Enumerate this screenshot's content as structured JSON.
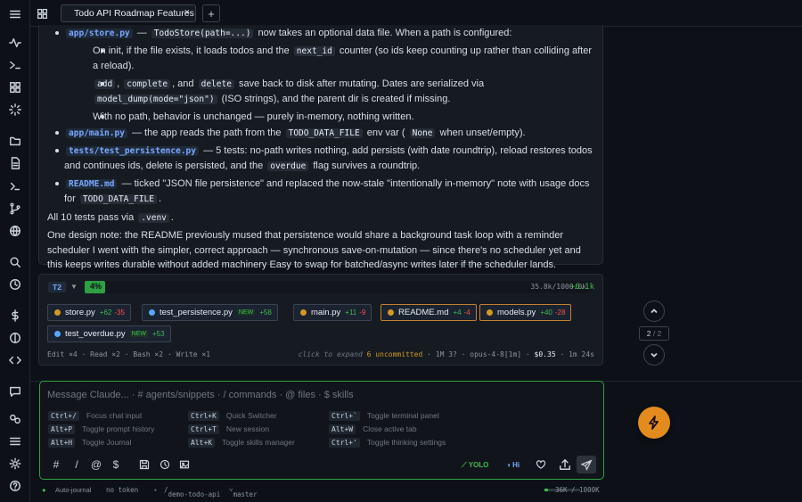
{
  "tabs": [
    {
      "label": "Todo API Roadmap Features"
    }
  ],
  "message": {
    "store_file": "app/store.py",
    "store_sig": "TodoStore(path=...)",
    "store_desc": "now takes an optional data file. When a path is configured:",
    "sub1_a": "On init, if the file exists, it loads todos and the",
    "sub1_code": "next_id",
    "sub1_b": "counter (so ids keep counting up rather than colliding after a reload).",
    "sub2_c1": "add",
    "sub2_c2": "complete",
    "sub2_c3": "delete",
    "sub2_a": "save back to disk after mutating. Dates are serialized via",
    "sub2_code": "model_dump(mode=\"json\")",
    "sub2_b": "(ISO strings), and the parent dir is created if missing.",
    "sub3": "With no path, behavior is unchanged — purely in-memory, nothing written.",
    "main_file": "app/main.py",
    "main_a": "— the app reads the path from the",
    "main_code": "TODO_DATA_FILE",
    "main_b": "env var (",
    "main_code2": "None",
    "main_c": "when unset/empty).",
    "tests_file": "tests/test_persistence.py",
    "tests_desc": "— 5 tests: no-path writes nothing, add persists (with date roundtrip), reload restores todos and continues ids, delete is persisted, and the",
    "tests_code": "overdue",
    "tests_desc2": "flag survives a roundtrip.",
    "readme_file": "README.md",
    "readme_desc": "— ticked \"JSON file persistence\" and replaced the now-stale \"intentionally in-memory\" note with usage docs for",
    "readme_code": "TODO_DATA_FILE",
    "tests_pass": "All 10 tests pass via",
    "tests_pass_code": ".venv",
    "design_note": "One design note: the README previously mused that persistence would share a background task loop with a reminder scheduler I went with the simpler, correct approach — synchronous save-on-mutation — since there's no scheduler yet and this keeps writes durable without added machinery     Easy to swap for batched/async writes later if the scheduler lands."
  },
  "tool_panel": {
    "badge": "T2",
    "progress_pct": 4,
    "progress_label": "4%",
    "tokens": "35.8k/1000.0k",
    "delta": "+6.1k",
    "files": [
      {
        "name": "store.py",
        "plus": "+62",
        "minus": "-35",
        "color": "#d29922"
      },
      {
        "name": "test_persistence.py",
        "new": "NEW",
        "plus": "+58",
        "color": "#58a6ff"
      },
      {
        "name": "main.py",
        "plus": "+11",
        "minus": "-9",
        "color": "#d29922"
      },
      {
        "name": "README.md",
        "plus": "+4",
        "minus": "-4",
        "color": "#d29922"
      },
      {
        "name": "models.py",
        "plus": "+40",
        "minus": "-28",
        "color": "#d29922"
      },
      {
        "name": "test_overdue.py",
        "new": "NEW",
        "plus": "+53",
        "color": "#58a6ff"
      }
    ],
    "footer_counts": "Edit ×4 · Read ×2 · Bash ×2 · Write ×1",
    "hint": "click to expand",
    "uncommitted": "6 uncommitted",
    "stats": "· 1M 3? · opus-4-8[1m] ·",
    "cost": "$0.35",
    "elapsed": "· 1m 24s"
  },
  "pager": {
    "current": "2",
    "total": "/ 2"
  },
  "composer": {
    "placeholder": "Message Claude...  ·  # agents/snippets  ·  / commands  ·  @ files  ·  $ skills",
    "shortcuts": [
      {
        "key": "Ctrl+/",
        "desc": "Focus chat input"
      },
      {
        "key": "Ctrl+K",
        "desc": "Quick Switcher"
      },
      {
        "key": "Ctrl+`",
        "desc": "Toggle terminal panel"
      },
      {
        "key": "Alt+P",
        "desc": "Toggle prompt history"
      },
      {
        "key": "Ctrl+T",
        "desc": "New session"
      },
      {
        "key": "Alt+W",
        "desc": "Close active tab"
      },
      {
        "key": "Alt+H",
        "desc": "Toggle Journal"
      },
      {
        "key": "Alt+K",
        "desc": "Toggle skills manager"
      },
      {
        "key": "Ctrl+'",
        "desc": "Toggle thinking settings"
      }
    ],
    "yolo": "YOLO",
    "hi": "Hi"
  },
  "status": {
    "journal": "Auto-journal",
    "token": "no token",
    "folder": "demo-todo-api",
    "branch": "master",
    "ctx": "36K / 1000K"
  },
  "colors": {
    "accent": "#2ea043",
    "bolt": "#e38b1f",
    "link": "#79a7ff"
  }
}
